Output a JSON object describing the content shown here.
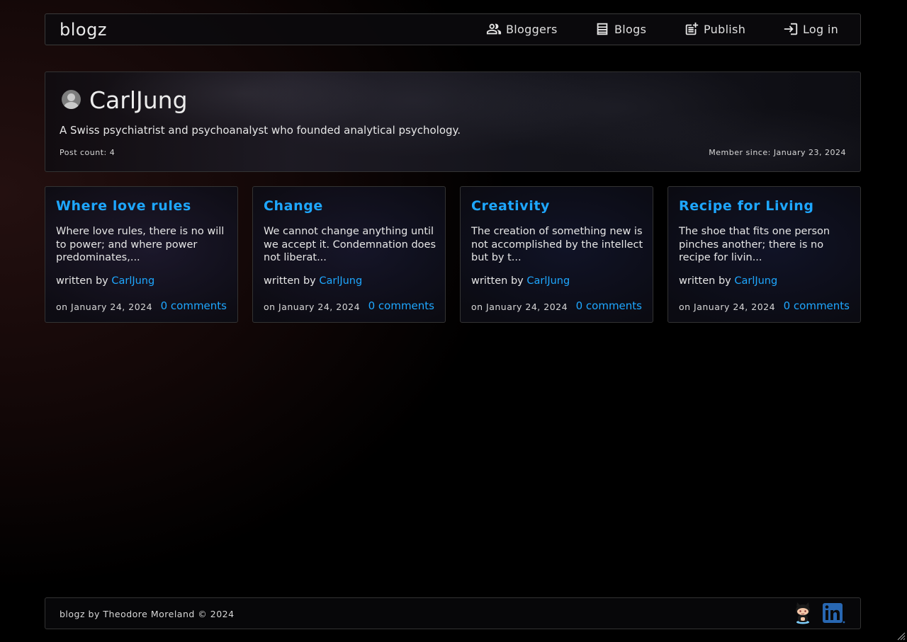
{
  "brand": "blogz",
  "nav": {
    "bloggers": "Bloggers",
    "blogs": "Blogs",
    "publish": "Publish",
    "login": "Log in"
  },
  "profile": {
    "name": "CarlJung",
    "bio": "A Swiss psychiatrist and psychoanalyst who founded analytical psychology.",
    "post_count": "Post count: 4",
    "member_since": "Member since: January 23, 2024"
  },
  "posts": [
    {
      "title": "Where love rules",
      "excerpt": "Where love rules, there is no will to power; and where power predominates,...",
      "written_by": "written by",
      "author": "CarlJung",
      "date": "on January 24, 2024",
      "comments": "0 comments"
    },
    {
      "title": "Change",
      "excerpt": "We cannot change anything until we accept it. Condemnation does not liberat...",
      "written_by": "written by",
      "author": "CarlJung",
      "date": "on January 24, 2024",
      "comments": "0 comments"
    },
    {
      "title": "Creativity",
      "excerpt": "The creation of something new is not accomplished by the intellect but by t...",
      "written_by": "written by",
      "author": "CarlJung",
      "date": "on January 24, 2024",
      "comments": "0 comments"
    },
    {
      "title": "Recipe for Living",
      "excerpt": "The shoe that fits one person pinches another; there is no recipe for livin...",
      "written_by": "written by",
      "author": "CarlJung",
      "date": "on January 24, 2024",
      "comments": "0 comments"
    }
  ],
  "footer": {
    "text": "blogz by Theodore Moreland © 2024",
    "icons": [
      "github-icon",
      "linkedin-icon"
    ]
  },
  "colors": {
    "accent": "#1ea7ff",
    "background": "#000000",
    "linkedin": "#2867b2"
  }
}
